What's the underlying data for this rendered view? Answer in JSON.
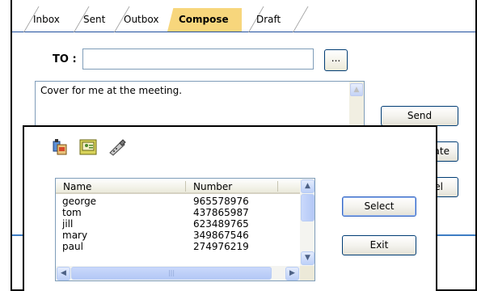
{
  "tabs": [
    {
      "label": "Inbox",
      "active": false
    },
    {
      "label": "Sent",
      "active": false
    },
    {
      "label": "Outbox",
      "active": false
    },
    {
      "label": "Compose",
      "active": true
    },
    {
      "label": "Draft",
      "active": false
    }
  ],
  "compose": {
    "to_label": "TO :",
    "to_value": "",
    "browse_label": "...",
    "message": "Cover for me at the meeting.",
    "send_label": "Send",
    "update_label_partial": "ate",
    "cancel_label_partial": "tel"
  },
  "contacts_dialog": {
    "icons": [
      "add-contact-icon",
      "contact-card-icon",
      "phone-icon"
    ],
    "columns": [
      "Name",
      "Number"
    ],
    "rows": [
      {
        "name": "george",
        "number": "965578976"
      },
      {
        "name": "tom",
        "number": "437865987"
      },
      {
        "name": "jill",
        "number": "623489765"
      },
      {
        "name": "mary",
        "number": "349867546"
      },
      {
        "name": "paul",
        "number": "274976219"
      }
    ],
    "select_label": "Select",
    "exit_label": "Exit"
  },
  "colors": {
    "active_tab": "#f7d67c",
    "divider_blue": "#3d7dc4",
    "button_border": "#003c74"
  }
}
